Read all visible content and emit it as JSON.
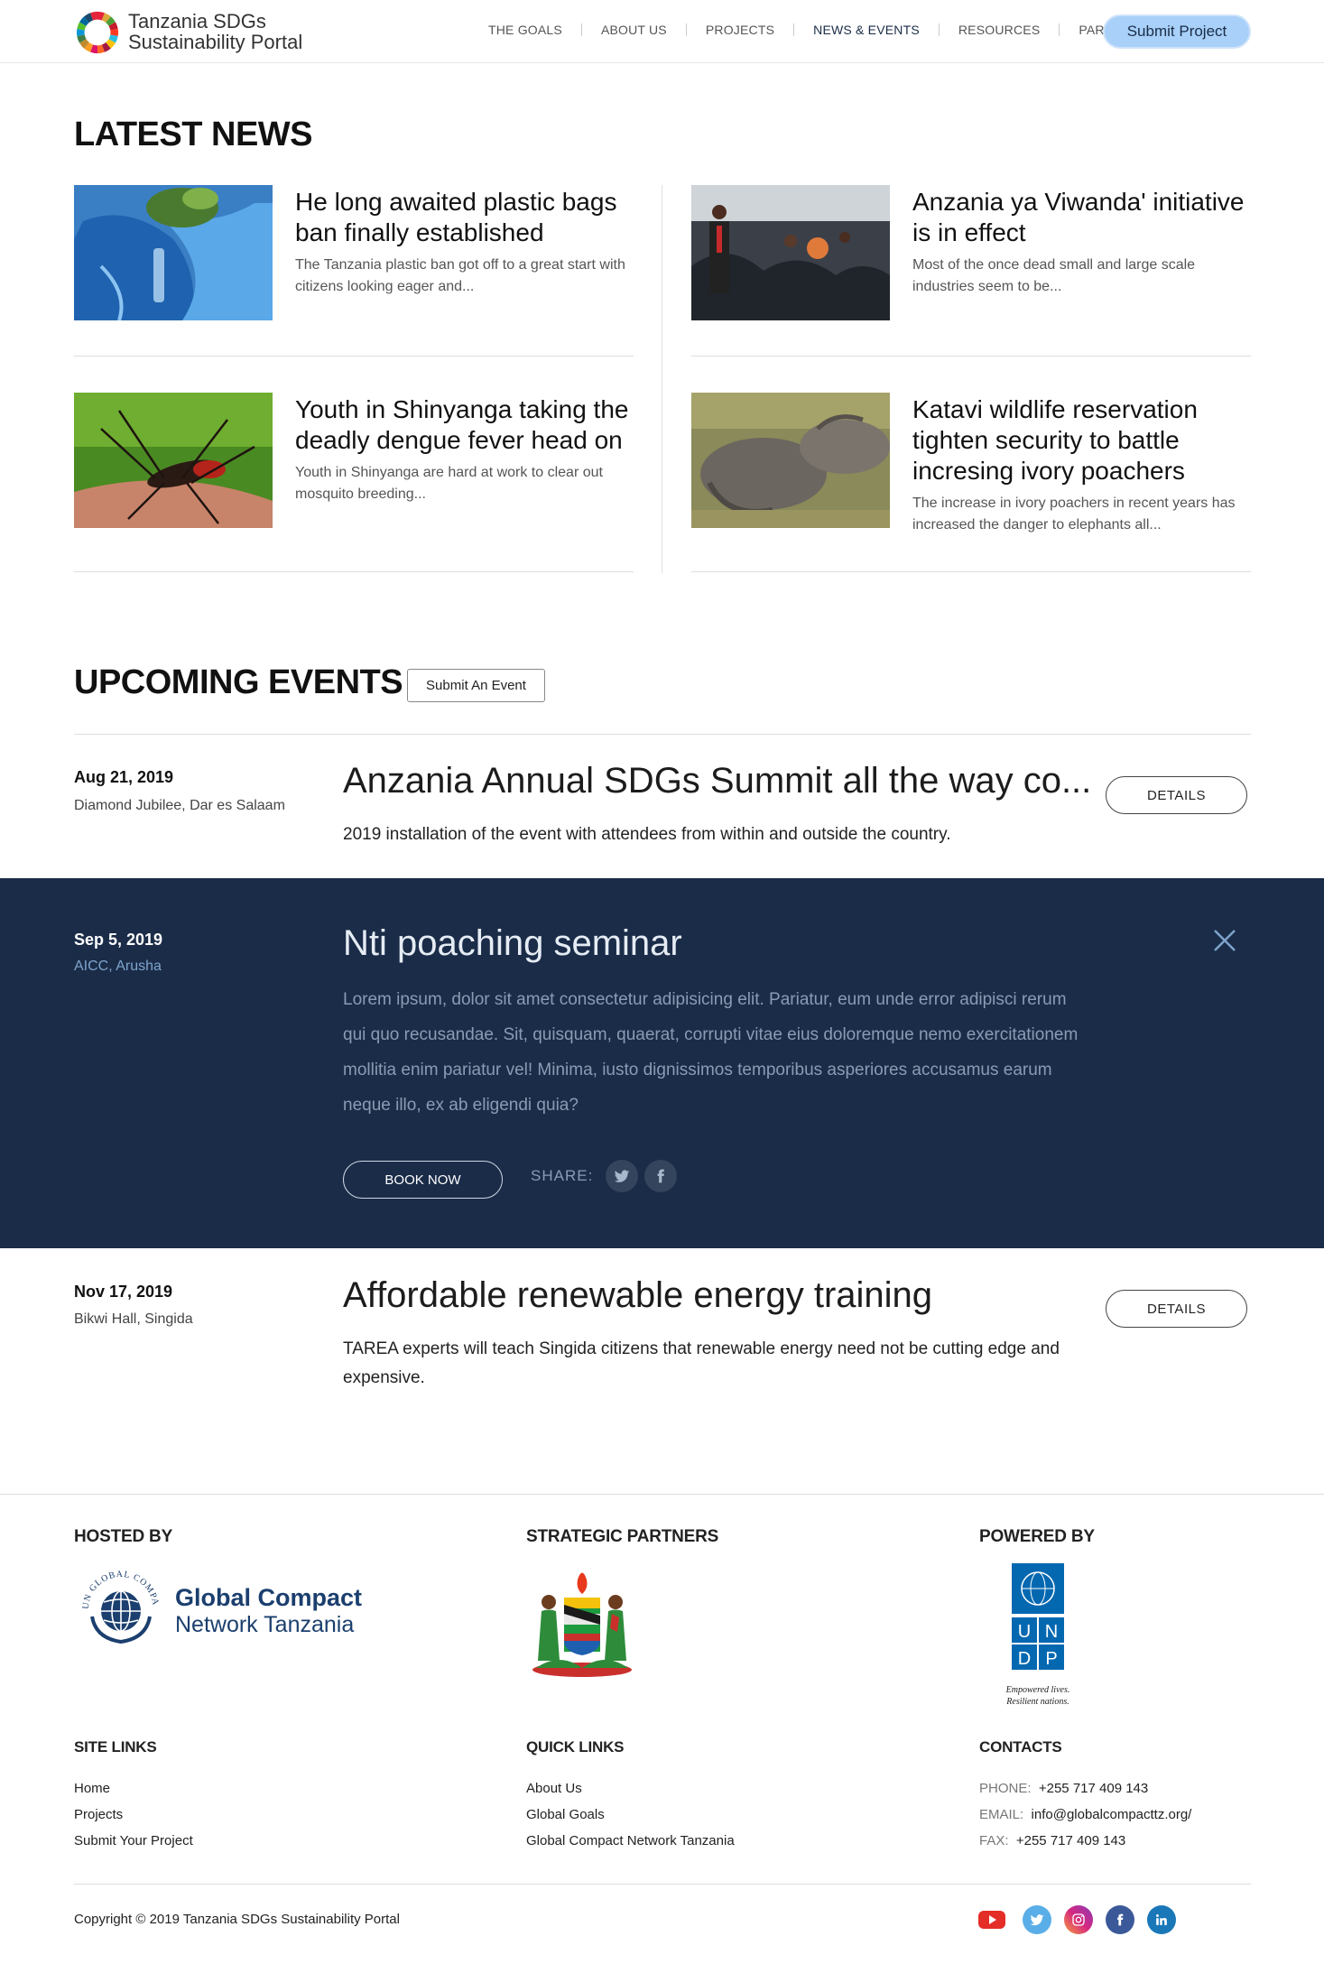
{
  "header": {
    "brand_line1": "Tanzania SDGs",
    "brand_line2": "Sustainability Portal",
    "nav": [
      "THE GOALS",
      "ABOUT US",
      "PROJECTS",
      "NEWS & EVENTS",
      "RESOURCES",
      "PARTNERS"
    ],
    "active_nav": "NEWS & EVENTS",
    "submit_label": "Submit Project",
    "accent_color": "#a8d0f8"
  },
  "news": {
    "title": "LATEST NEWS",
    "items": [
      {
        "title": "He long awaited plastic bags ban finally established",
        "excerpt": "The Tanzania plastic ban got off to a great start with citizens looking eager and..."
      },
      {
        "title": "Anzania ya Viwanda' initiative is in effect",
        "excerpt": "Most of the once dead small and large scale industries seem to be..."
      },
      {
        "title": "Youth in Shinyanga taking the deadly dengue fever head on",
        "excerpt": "Youth in Shinyanga are hard at work to clear out mosquito breeding..."
      },
      {
        "title": "Katavi wildlife reservation tighten security to battle incresing ivory poachers",
        "excerpt": "The increase in ivory poachers in recent years has increased the danger to elephants all..."
      }
    ]
  },
  "events": {
    "title": "UPCOMING EVENTS",
    "submit_label": "Submit An Event",
    "items": [
      {
        "date": "Aug 21, 2019",
        "location": "Diamond Jubilee, Dar es Salaam",
        "title": "Anzania Annual SDGs Summit all the way co...",
        "description": "2019 installation of the event with attendees from within and outside the country.",
        "button": "DETAILS"
      },
      {
        "date": "Sep 5, 2019",
        "location": "AICC, Arusha",
        "title": "Nti poaching seminar",
        "description": "Lorem ipsum, dolor sit amet consectetur adipisicing elit. Pariatur, eum unde error adipisci rerum qui quo recusandae. Sit, quisquam, quaerat, corrupti vitae eius doloremque nemo exercitationem mollitia enim pariatur vel! Minima, iusto dignissimos temporibus asperiores accusamus earum neque illo, ex ab eligendi quia?",
        "button": "BOOK NOW",
        "share_label": "SHARE:"
      },
      {
        "date": "Nov 17, 2019",
        "location": "Bikwi Hall, Singida",
        "title": "Affordable renewable energy training",
        "description": "TAREA experts will teach Singida citizens that renewable energy need not be cutting edge and expensive.",
        "button": "DETAILS"
      }
    ],
    "dark_bg": "#1a2c48"
  },
  "footer": {
    "hosted_by": "HOSTED BY",
    "strategic_partners": "STRATEGIC PARTNERS",
    "powered_by": "POWERED BY",
    "gc_name_line1": "Global Compact",
    "gc_name_line2": "Network Tanzania",
    "gc_ring_text": "UN GLOBAL COMPACT",
    "undp_tagline1": "Empowered lives.",
    "undp_tagline2": "Resilient nations.",
    "site_links_title": "SITE LINKS",
    "site_links": [
      "Home",
      "Projects",
      "Submit Your Project"
    ],
    "quick_links_title": "QUICK LINKS",
    "quick_links": [
      "About Us",
      "Global Goals",
      "Global Compact Network Tanzania"
    ],
    "contacts_title": "CONTACTS",
    "contacts": [
      {
        "label": "PHONE:",
        "value": "+255 717 409 143"
      },
      {
        "label": "EMAIL:",
        "value": "info@globalcompacttz.org/"
      },
      {
        "label": "FAX:",
        "value": "+255 717 409 143"
      }
    ],
    "copyright": "Copyright © 2019 Tanzania SDGs Sustainability Portal",
    "social_icons": [
      "youtube-icon",
      "twitter-icon",
      "instagram-icon",
      "facebook-icon",
      "linkedin-icon"
    ]
  }
}
